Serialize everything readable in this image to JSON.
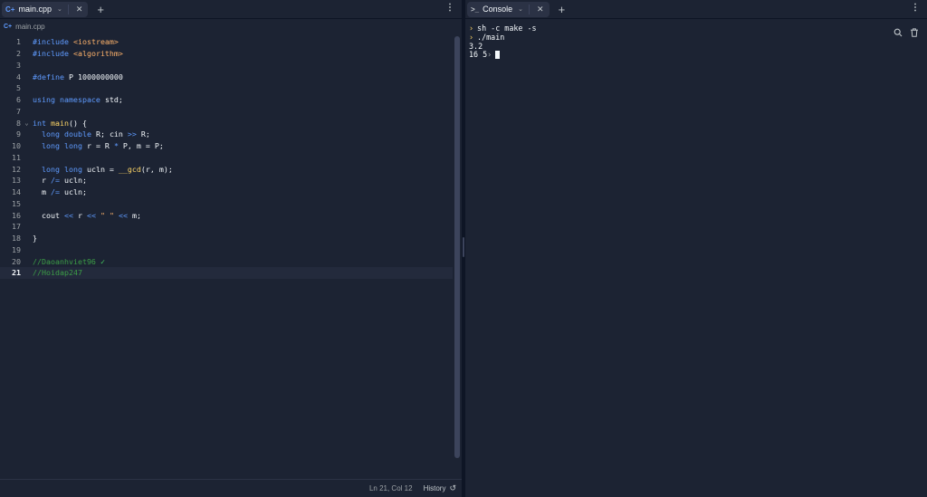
{
  "editor": {
    "tab": {
      "label": "main.cpp",
      "icon": "cpp-file-icon"
    },
    "breadcrumb": "main.cpp",
    "lines": [
      {
        "n": "1",
        "segs": [
          [
            "kw",
            "#include "
          ],
          [
            "str",
            "<iostream>"
          ]
        ]
      },
      {
        "n": "2",
        "segs": [
          [
            "kw",
            "#include "
          ],
          [
            "str",
            "<algorithm>"
          ]
        ]
      },
      {
        "n": "3",
        "segs": []
      },
      {
        "n": "4",
        "segs": [
          [
            "kw",
            "#define "
          ],
          [
            "txt",
            "P "
          ],
          [
            "num",
            "1000000000"
          ]
        ]
      },
      {
        "n": "5",
        "segs": []
      },
      {
        "n": "6",
        "segs": [
          [
            "kw",
            "using namespace "
          ],
          [
            "txt",
            "std;"
          ]
        ]
      },
      {
        "n": "7",
        "segs": []
      },
      {
        "n": "8",
        "fold": true,
        "segs": [
          [
            "kw",
            "int "
          ],
          [
            "fn",
            "main"
          ],
          [
            "txt",
            "() {"
          ]
        ]
      },
      {
        "n": "9",
        "segs": [
          [
            "txt",
            "  "
          ],
          [
            "kw",
            "long double "
          ],
          [
            "txt",
            "R; cin "
          ],
          [
            "kw",
            ">>"
          ],
          [
            "txt",
            " R;"
          ]
        ]
      },
      {
        "n": "10",
        "segs": [
          [
            "txt",
            "  "
          ],
          [
            "kw",
            "long long "
          ],
          [
            "txt",
            "r = R "
          ],
          [
            "kw",
            "*"
          ],
          [
            "txt",
            " P, m = P;"
          ]
        ]
      },
      {
        "n": "11",
        "segs": []
      },
      {
        "n": "12",
        "segs": [
          [
            "txt",
            "  "
          ],
          [
            "kw",
            "long long "
          ],
          [
            "txt",
            "ucln = "
          ],
          [
            "fn",
            "__gcd"
          ],
          [
            "txt",
            "(r, m);"
          ]
        ]
      },
      {
        "n": "13",
        "segs": [
          [
            "txt",
            "  r "
          ],
          [
            "kw",
            "/="
          ],
          [
            "txt",
            " ucln;"
          ]
        ]
      },
      {
        "n": "14",
        "segs": [
          [
            "txt",
            "  m "
          ],
          [
            "kw",
            "/="
          ],
          [
            "txt",
            " ucln;"
          ]
        ]
      },
      {
        "n": "15",
        "segs": []
      },
      {
        "n": "16",
        "segs": [
          [
            "txt",
            "  cout "
          ],
          [
            "kw",
            "<<"
          ],
          [
            "txt",
            " r "
          ],
          [
            "kw",
            "<<"
          ],
          [
            "txt",
            " "
          ],
          [
            "str",
            "\" \""
          ],
          [
            "txt",
            " "
          ],
          [
            "kw",
            "<<"
          ],
          [
            "txt",
            " m;"
          ]
        ]
      },
      {
        "n": "17",
        "segs": []
      },
      {
        "n": "18",
        "segs": [
          [
            "txt",
            "}"
          ]
        ]
      },
      {
        "n": "19",
        "segs": []
      },
      {
        "n": "20",
        "segs": [
          [
            "cm",
            "//Daoanhviet96 "
          ],
          [
            "chk",
            "✓"
          ]
        ]
      },
      {
        "n": "21",
        "active": true,
        "segs": [
          [
            "cm",
            "//Hoidap247"
          ]
        ]
      }
    ],
    "status": {
      "position": "Ln 21, Col 12",
      "history_label": "History"
    }
  },
  "console": {
    "tab": {
      "label": "Console",
      "icon": "terminal-icon"
    },
    "lines": [
      {
        "type": "cmd",
        "text": "sh -c make -s"
      },
      {
        "type": "cmd",
        "text": "./main"
      },
      {
        "type": "out",
        "text": "3.2"
      },
      {
        "type": "out",
        "text": "16 5"
      }
    ]
  }
}
